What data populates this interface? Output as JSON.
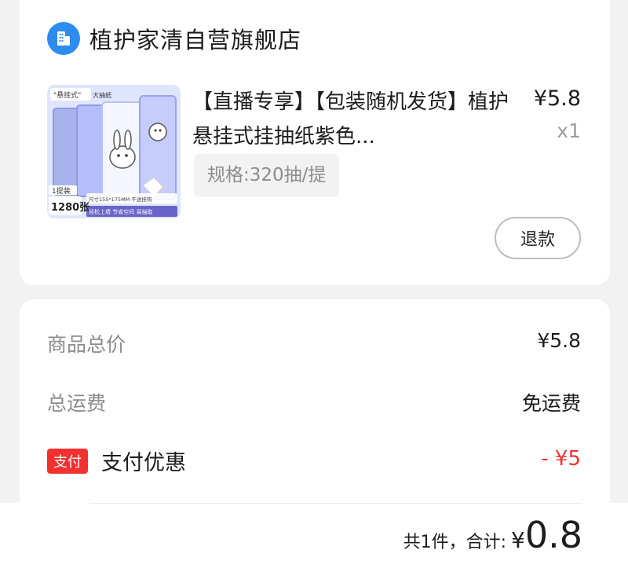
{
  "store": {
    "icon": "store-building-icon",
    "name": "植护家清自营旗舰店"
  },
  "product": {
    "image_texts": {
      "top_tag": "\"悬挂式\"",
      "top_tag2": "大抽纸",
      "pack_label": "1提装",
      "count_label": "1280张",
      "size_note": "尺寸155*175MM 不送挂钩",
      "bottom_note": "轻松上墙 节省空间 易抽取"
    },
    "title": "【直播专享】【包装随机发货】植护悬挂式挂抽纸紫色...",
    "price": "¥5.8",
    "quantity": "x1",
    "spec": "规格:320抽/提",
    "refund_label": "退款"
  },
  "summary": {
    "goods_total_label": "商品总价",
    "goods_total_value": "¥5.8",
    "shipping_label": "总运费",
    "shipping_value": "免运费",
    "pay_badge": "支付",
    "pay_discount_label": "支付优惠",
    "pay_discount_value": "- ¥5"
  },
  "footer": {
    "count_total_label": "共1件，合计:",
    "currency": "¥",
    "amount": "0.8"
  },
  "colors": {
    "accent_blue": "#2d8cf0",
    "discount_red": "#f23030",
    "background": "#f2f2f2"
  }
}
